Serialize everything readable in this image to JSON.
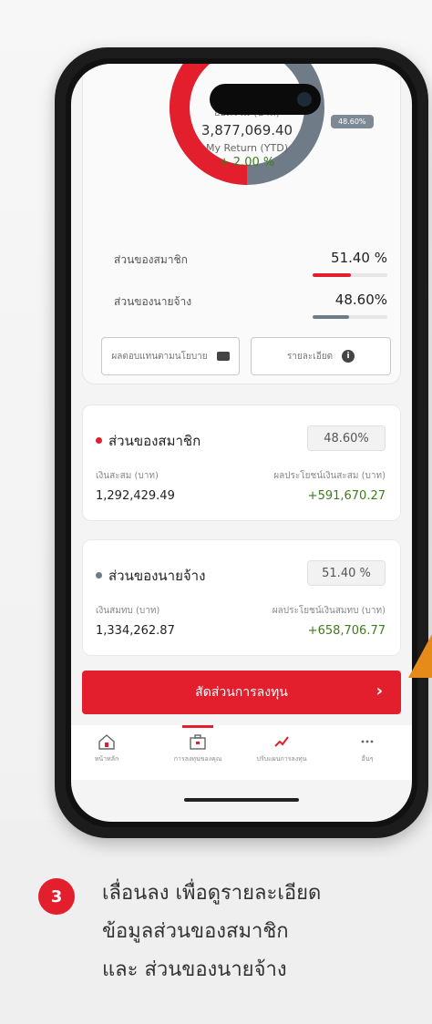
{
  "summary": {
    "total_label": "ยอดรวม (บาท)",
    "total_value": "3,877,069.40",
    "return_label": "My Return (YTD)",
    "return_value": "+ 2.00 %",
    "donut_badge": "48.60%",
    "ratios": [
      {
        "name": "ส่วนของสมาชิก",
        "value": "51.40 %",
        "fraction": 0.514,
        "color": "#e31e2d"
      },
      {
        "name": "ส่วนของนายจ้าง",
        "value": "48.60%",
        "fraction": 0.486,
        "color": "#6f7c87"
      }
    ],
    "buttons": {
      "performance": "ผลตอบแทนตามนโยบาย",
      "details": "รายละเอียด"
    }
  },
  "member": {
    "title": "ส่วนของสมาชิก",
    "percent": "48.60%",
    "left_label": "เงินสะสม (บาท)",
    "left_value": "1,292,429.49",
    "right_label": "ผลประโยชน์เงินสะสม (บาท)",
    "right_value": "+591,670.27",
    "dot_color": "#e31e2d"
  },
  "employer": {
    "title": "ส่วนของนายจ้าง",
    "percent": "51.40 %",
    "left_label": "เงินสมทบ (บาท)",
    "left_value": "1,334,262.87",
    "right_label": "ผลประโยชน์เงินสมทบ (บาท)",
    "right_value": "+658,706.77",
    "dot_color": "#6f7c87"
  },
  "cta_label": "สัดส่วนการลงทุน",
  "tabs": [
    {
      "label": "หน้าหลัก",
      "icon": "home-icon"
    },
    {
      "label": "การลงทุนของคุณ",
      "icon": "briefcase-icon"
    },
    {
      "label": "ปรับแผนการลงทุน",
      "icon": "trend-icon"
    },
    {
      "label": "อื่นๆ",
      "icon": "more-icon"
    }
  ],
  "caption": {
    "step": "3",
    "line1": "เลื่อนลง เพื่อดูรายละเอียด",
    "line2": "ข้อมูลส่วนของสมาชิก",
    "line3": "และ ส่วนของนายจ้าง"
  },
  "colors": {
    "accent": "#e31e2d",
    "gray": "#6f7c87",
    "positive": "#3e7b1e",
    "pointer": "#e68a19"
  }
}
